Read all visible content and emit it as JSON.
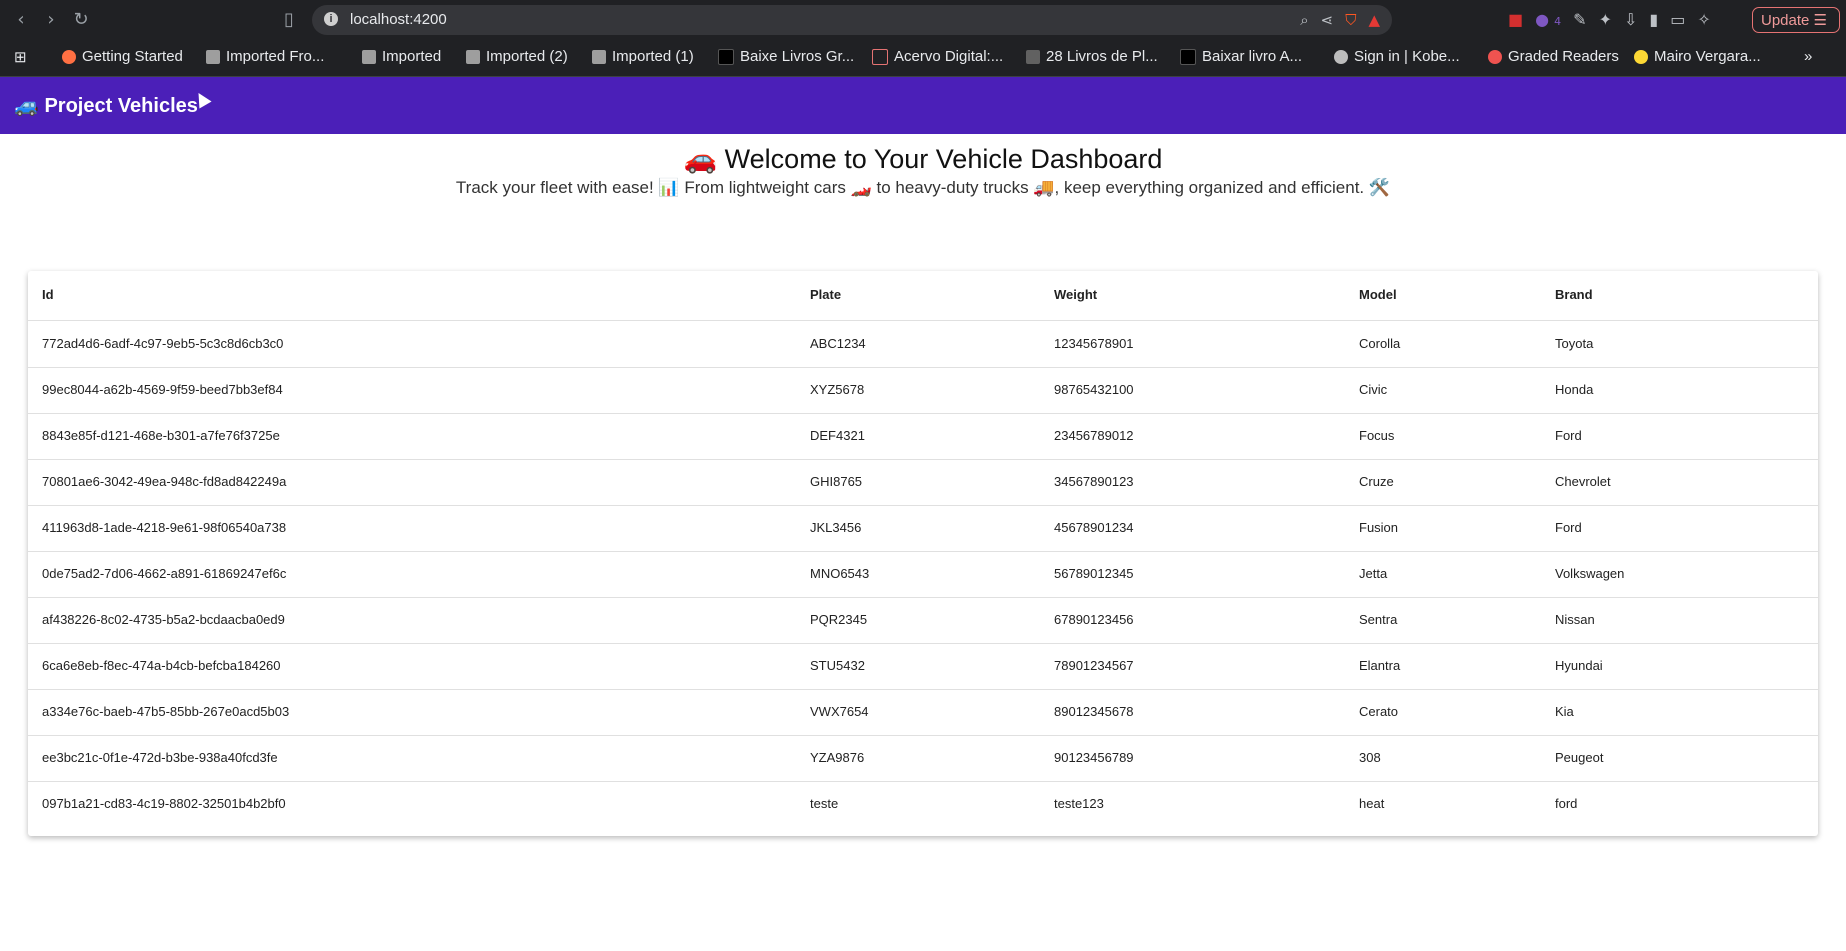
{
  "browser": {
    "url": "localhost:4200",
    "update_label": "Update",
    "extension_badge": "4",
    "bookmarks": [
      "Getting Started",
      "Imported Fro...",
      "Imported",
      "Imported (2)",
      "Imported (1)",
      "Baixe Livros Gr...",
      "Acervo Digital:...",
      "28 Livros de Pl...",
      "Baixar livro A...",
      "Sign in | Kobe...",
      "Graded Readers",
      "Mairo Vergara..."
    ]
  },
  "app": {
    "title": "🚙 Project Vehicles",
    "hero_title": "🚗 Welcome to Your Vehicle Dashboard",
    "hero_subtitle": "Track your fleet with ease! 📊 From lightweight cars 🏎️ to heavy-duty trucks 🚚, keep everything organized and efficient. 🛠️"
  },
  "table": {
    "headers": [
      "Id",
      "Plate",
      "Weight",
      "Model",
      "Brand"
    ],
    "rows": [
      [
        "772ad4d6-6adf-4c97-9eb5-5c3c8d6cb3c0",
        "ABC1234",
        "12345678901",
        "Corolla",
        "Toyota"
      ],
      [
        "99ec8044-a62b-4569-9f59-beed7bb3ef84",
        "XYZ5678",
        "98765432100",
        "Civic",
        "Honda"
      ],
      [
        "8843e85f-d121-468e-b301-a7fe76f3725e",
        "DEF4321",
        "23456789012",
        "Focus",
        "Ford"
      ],
      [
        "70801ae6-3042-49ea-948c-fd8ad842249a",
        "GHI8765",
        "34567890123",
        "Cruze",
        "Chevrolet"
      ],
      [
        "411963d8-1ade-4218-9e61-98f06540a738",
        "JKL3456",
        "45678901234",
        "Fusion",
        "Ford"
      ],
      [
        "0de75ad2-7d06-4662-a891-61869247ef6c",
        "MNO6543",
        "56789012345",
        "Jetta",
        "Volkswagen"
      ],
      [
        "af438226-8c02-4735-b5a2-bcdaacba0ed9",
        "PQR2345",
        "67890123456",
        "Sentra",
        "Nissan"
      ],
      [
        "6ca6e8eb-f8ec-474a-b4cb-befcba184260",
        "STU5432",
        "78901234567",
        "Elantra",
        "Hyundai"
      ],
      [
        "a334e76c-baeb-47b5-85bb-267e0acd5b03",
        "VWX7654",
        "89012345678",
        "Cerato",
        "Kia"
      ],
      [
        "ee3bc21c-0f1e-472d-b3be-938a40fcd3fe",
        "YZA9876",
        "90123456789",
        "308",
        "Peugeot"
      ],
      [
        "097b1a21-cd83-4c19-8802-32501b4b2bf0",
        "teste",
        "teste123",
        "heat",
        "ford"
      ]
    ]
  },
  "colors": {
    "toolbar": "#4b1fb8",
    "chrome": "#202124"
  }
}
